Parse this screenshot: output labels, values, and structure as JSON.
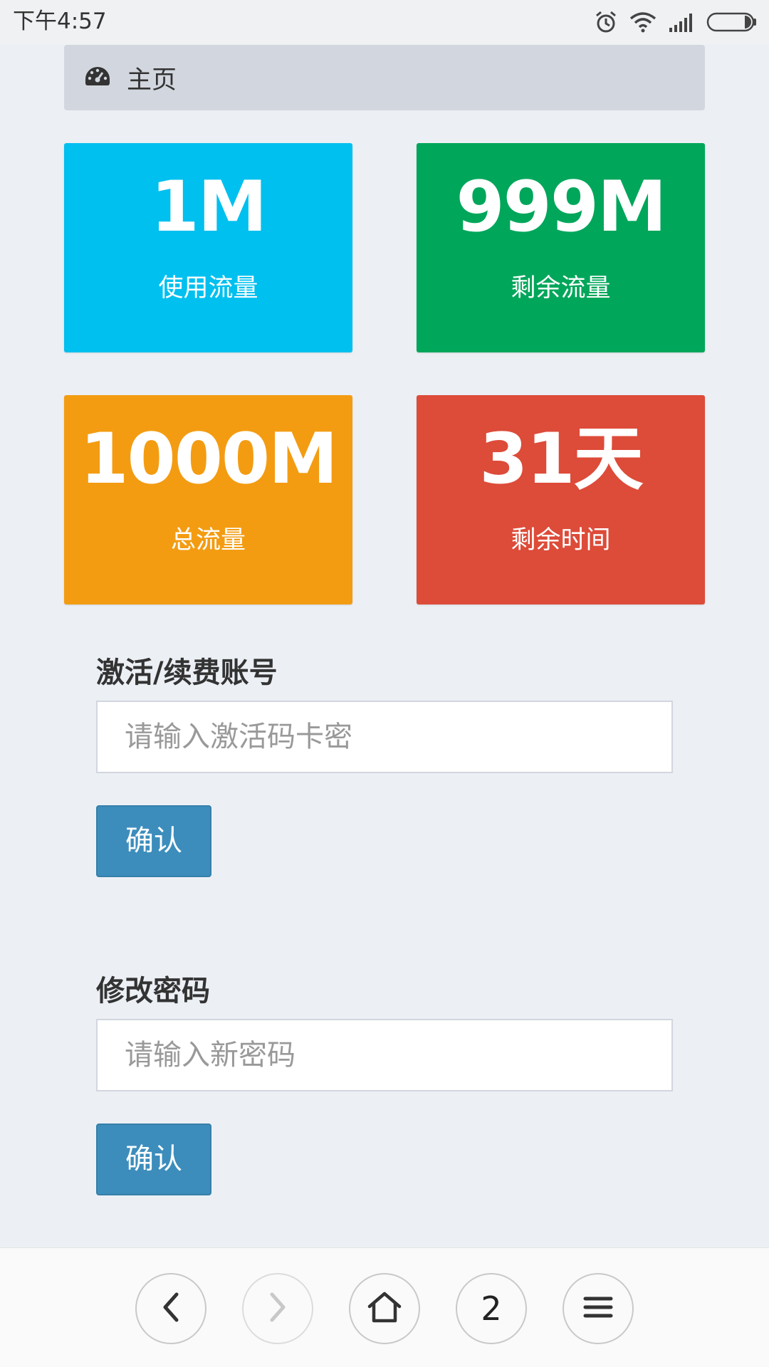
{
  "status_bar": {
    "time": "下午4:57"
  },
  "breadcrumb": {
    "label": "主页",
    "icon": "dashboard-icon"
  },
  "stats": [
    {
      "value": "1M",
      "label": "使用流量",
      "color": "#00c0ef"
    },
    {
      "value": "999M",
      "label": "剩余流量",
      "color": "#00a65a"
    },
    {
      "value": "1000M",
      "label": "总流量",
      "color": "#f39c12"
    },
    {
      "value": "31天",
      "label": "剩余时间",
      "color": "#dd4b39"
    }
  ],
  "activate": {
    "title": "激活/续费账号",
    "placeholder": "请输入激活码卡密",
    "value": "",
    "button": "确认"
  },
  "password": {
    "title": "修改密码",
    "placeholder": "请输入新密码",
    "value": "",
    "button": "确认"
  },
  "browser_nav": {
    "tab_count": "2"
  },
  "colors": {
    "primary_button": "#3c8dbc",
    "page_bg": "#ecf0f5",
    "breadcrumb_bg": "#d2d6de"
  }
}
